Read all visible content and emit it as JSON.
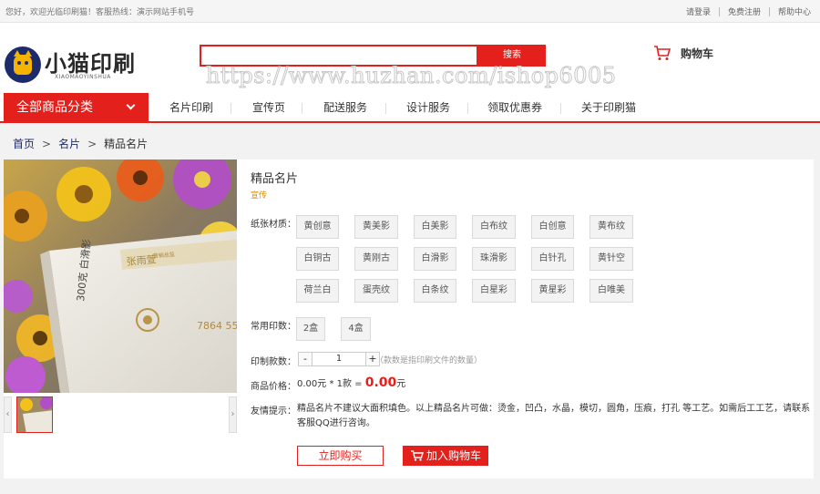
{
  "topbar": {
    "welcome": "您好，欢迎光临印刷猫！客服热线：演示网站手机号",
    "links": [
      "请登录",
      "免费注册",
      "帮助中心"
    ]
  },
  "header": {
    "logo_text": "小猫印刷",
    "logo_sub": "XIAOMAOYINSHUA",
    "search_placeholder": "",
    "search_button": "搜索",
    "watermark": "https://www.huzhan.com/ishop6005",
    "cart_label": "购物车"
  },
  "nav": {
    "all_categories": "全部商品分类",
    "items": [
      "名片印刷",
      "宣传页",
      "配送服务",
      "设计服务",
      "领取优惠券",
      "关于印刷猫"
    ]
  },
  "breadcrumb": [
    "首页",
    "名片",
    "精品名片"
  ],
  "product": {
    "title": "精品名片",
    "subtitle": "宣传",
    "paper_label": "纸张材质：",
    "papers": [
      "黄创意",
      "黄美影",
      "白美影",
      "白布纹",
      "白创意",
      "黄布纹",
      "白铜古",
      "黄刚古",
      "白滑影",
      "珠滑影",
      "白针孔",
      "黄针空",
      "荷兰白",
      "蛋壳纹",
      "白条纹",
      "白星彩",
      "黄星彩",
      "白唯美"
    ],
    "qty_label": "常用印数：",
    "qtys": [
      "2盒",
      "4盒"
    ],
    "count_label": "印制款数：",
    "count_minus": "-",
    "count_value": "1",
    "count_plus": "+",
    "count_hint": "（款数是指印刷文件的数量）",
    "price_label": "商品价格：",
    "price_unit": "0.00元",
    "price_mult": " * 1款 = ",
    "price_total": "0.00",
    "price_suffix": "元",
    "tip_label": "友情提示：",
    "tip_text": "精品名片不建议大面积填色。以上精品名片可做：烫金，凹凸，水晶，模切，圆角，压痕，打孔 等工艺。如需后工工艺，请联系客服QQ进行咨询。",
    "buy_now": "立即购买",
    "add_cart": "加入购物车"
  },
  "card_photo": {
    "name": "张雨萱",
    "title": "营销总监",
    "tel": "7864 55",
    "side_text": "300克 白滑影"
  },
  "colors": {
    "accent": "#e4201c",
    "logo_bg": "#1d2b6a",
    "subtitle": "#e08a00"
  }
}
